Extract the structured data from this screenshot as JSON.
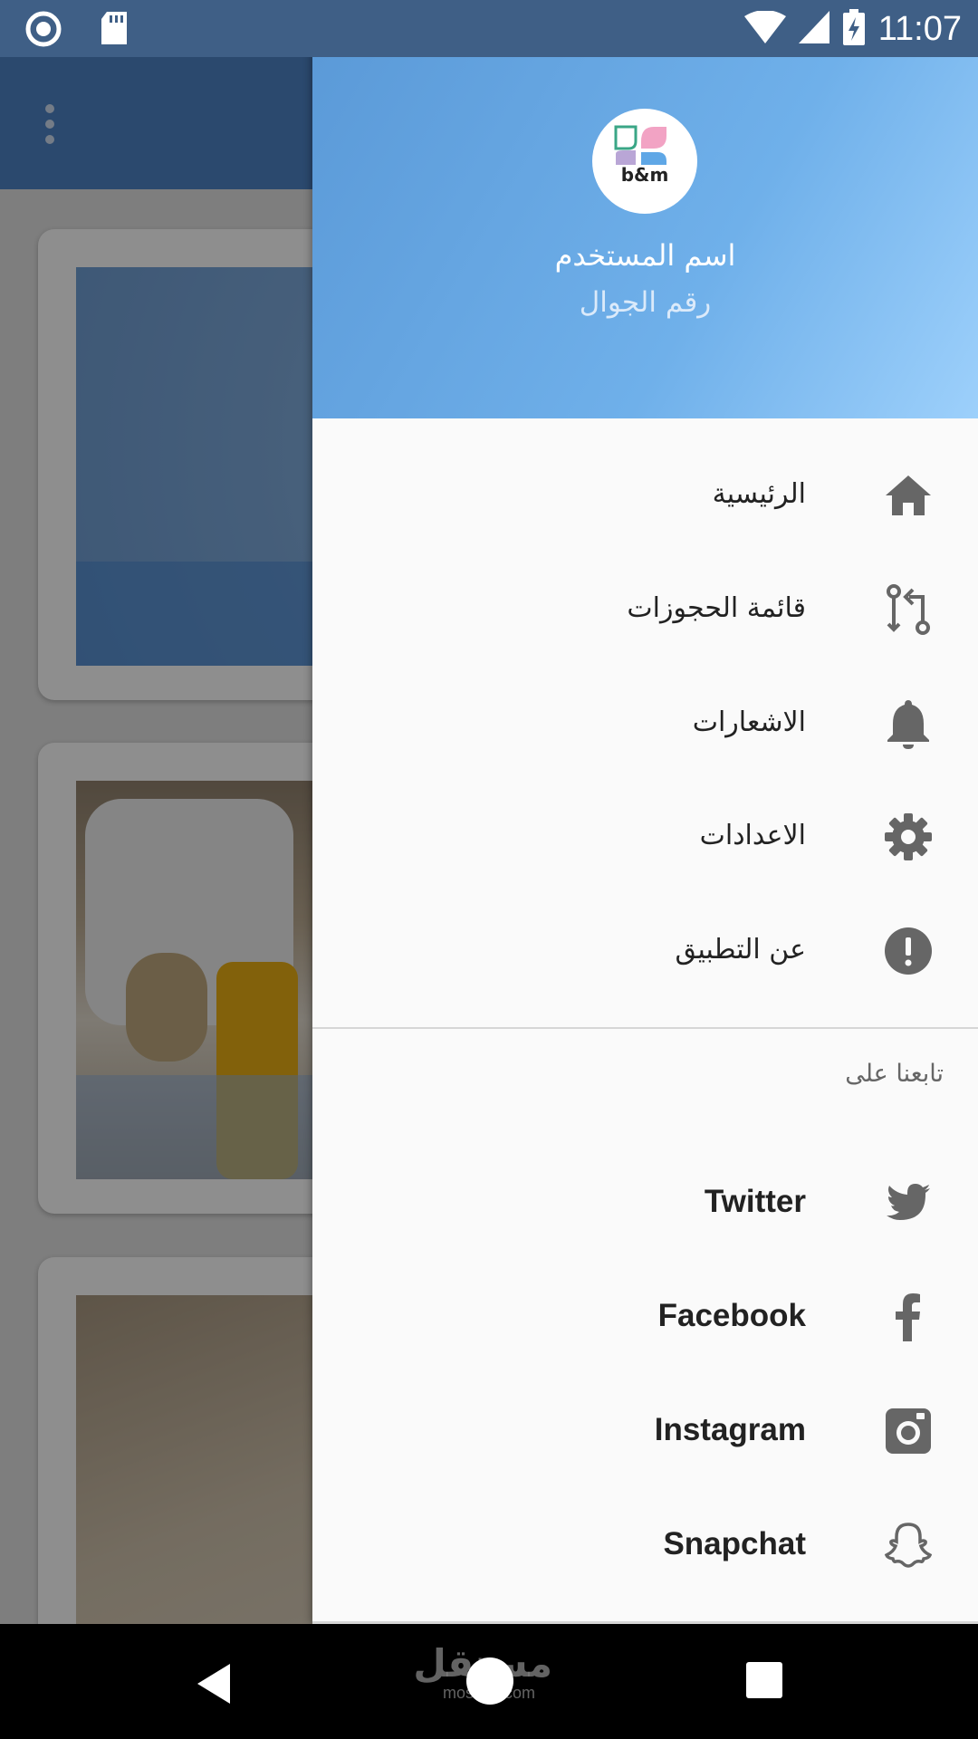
{
  "status_bar": {
    "time": "11:07"
  },
  "drawer": {
    "user_name": "اسم المستخدم",
    "user_phone": "رقم الجوال",
    "logo_text": "b&m",
    "menu": [
      {
        "label": "الرئيسية",
        "icon": "home-icon"
      },
      {
        "label": "قائمة الحجوزات",
        "icon": "compare-arrows-icon"
      },
      {
        "label": "الاشعارات",
        "icon": "bell-icon"
      },
      {
        "label": "الاعدادات",
        "icon": "gear-icon"
      },
      {
        "label": "عن التطبيق",
        "icon": "info-icon"
      }
    ],
    "follow_title": "تابعنا على",
    "social": [
      {
        "label": "Twitter",
        "icon": "twitter-icon"
      },
      {
        "label": "Facebook",
        "icon": "facebook-icon"
      },
      {
        "label": "Instagram",
        "icon": "instagram-icon"
      },
      {
        "label": "Snapchat",
        "icon": "snapchat-icon"
      }
    ]
  },
  "watermark": {
    "arabic": "مستقل",
    "latin": "mostaql.com"
  },
  "colors": {
    "header_start": "#5b9ad8",
    "header_end": "#9dd0fb",
    "toolbar": "#4b7fbe",
    "icon": "#666666"
  }
}
